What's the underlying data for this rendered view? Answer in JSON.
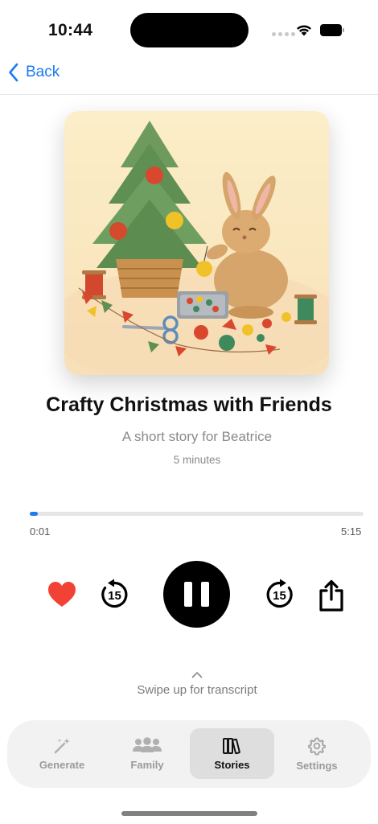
{
  "status_bar": {
    "time": "10:44"
  },
  "nav": {
    "back_label": "Back"
  },
  "story": {
    "title": "Crafty Christmas with Friends",
    "subtitle": "A short story for Beatrice",
    "duration": "5 minutes",
    "artwork_icon": "bunny-christmas-tree-illustration"
  },
  "player": {
    "elapsed": "0:01",
    "total": "5:15",
    "progress_fraction": 0.003,
    "skip_seconds": "15",
    "state": "playing",
    "favorite": true,
    "accent_color": "#1a7cf0",
    "heart_color": "#f24236"
  },
  "transcript_hint": {
    "label": "Swipe up for transcript"
  },
  "tabs": [
    {
      "label": "Generate",
      "icon": "magic-wand-icon",
      "selected": false
    },
    {
      "label": "Family",
      "icon": "people-icon",
      "selected": false
    },
    {
      "label": "Stories",
      "icon": "books-icon",
      "selected": true
    },
    {
      "label": "Settings",
      "icon": "gear-icon",
      "selected": false
    }
  ]
}
